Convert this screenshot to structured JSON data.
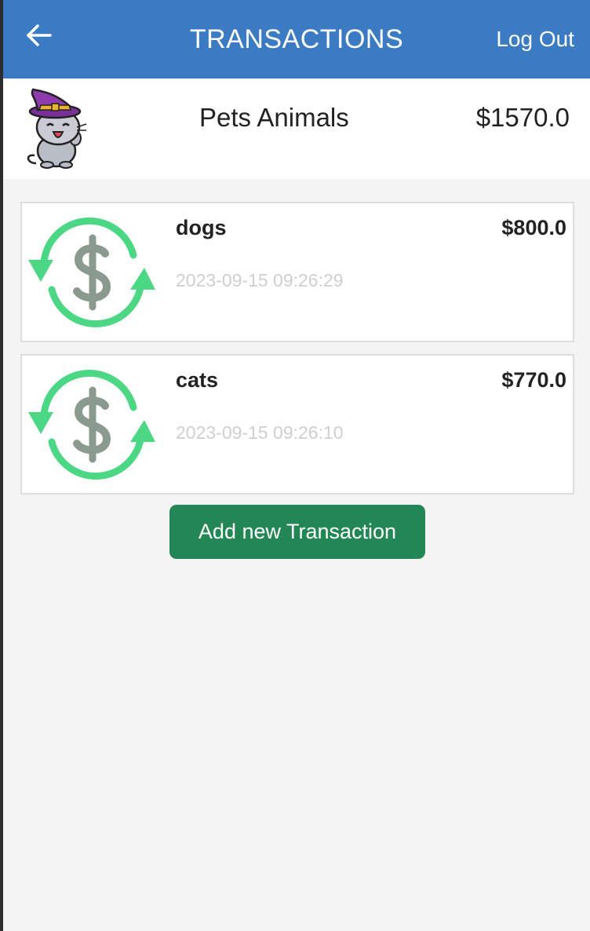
{
  "header": {
    "title": "TRANSACTIONS",
    "logout_label": "Log Out",
    "back_icon": "arrow-left-icon"
  },
  "account": {
    "avatar_icon": "cat-witch-hat-avatar",
    "name": "Pets Animals",
    "balance": "$1570.0"
  },
  "transactions": [
    {
      "icon": "money-exchange-icon",
      "name": "dogs",
      "amount": "$800.0",
      "date": "2023-09-15 09:26:29"
    },
    {
      "icon": "money-exchange-icon",
      "name": "cats",
      "amount": "$770.0",
      "date": "2023-09-15 09:26:10"
    }
  ],
  "actions": {
    "add_label": "Add new Transaction"
  },
  "colors": {
    "header_bg": "#3b7bc4",
    "page_bg": "#f4f4f4",
    "add_button_bg": "#228754",
    "icon_arrow": "#4cd784",
    "icon_dollar": "#8a9a8e",
    "date_text": "#cfcfcf"
  }
}
